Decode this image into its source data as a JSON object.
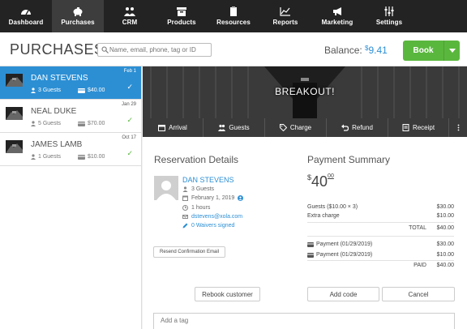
{
  "nav": [
    {
      "label": "Dashboard",
      "icon": "speedometer-icon"
    },
    {
      "label": "Purchases",
      "icon": "piggy-bank-icon"
    },
    {
      "label": "CRM",
      "icon": "people-icon"
    },
    {
      "label": "Products",
      "icon": "box-icon"
    },
    {
      "label": "Resources",
      "icon": "clipboard-icon"
    },
    {
      "label": "Reports",
      "icon": "line-chart-icon"
    },
    {
      "label": "Marketing",
      "icon": "megaphone-icon"
    },
    {
      "label": "Settings",
      "icon": "sliders-icon"
    }
  ],
  "header": {
    "title": "PURCHASES",
    "search_placeholder": "Name, email, phone, tag or ID",
    "balance_label": "Balance:",
    "balance_currency": "$",
    "balance_amount": "9.41",
    "book_label": "Book"
  },
  "bookings": [
    {
      "name": "DAN STEVENS",
      "date": "Feb 1",
      "guests": "3 Guests",
      "price": "$40.00",
      "active": true
    },
    {
      "name": "NEAL DUKE",
      "date": "Jan 29",
      "guests": "5 Guests",
      "price": "$70.00",
      "active": false
    },
    {
      "name": "JAMES LAMB",
      "date": "Oct 17",
      "guests": "1 Guests",
      "price": "$10.00",
      "active": false
    }
  ],
  "banner": {
    "title": "BREAKOUT!"
  },
  "actions": [
    {
      "label": "Arrival",
      "icon": "calendar-icon"
    },
    {
      "label": "Guests",
      "icon": "people-icon"
    },
    {
      "label": "Charge",
      "icon": "tag-icon"
    },
    {
      "label": "Refund",
      "icon": "undo-icon"
    },
    {
      "label": "Receipt",
      "icon": "receipt-icon"
    },
    {
      "label": "",
      "icon": "more-vertical-icon"
    }
  ],
  "reservation": {
    "title": "Reservation Details",
    "customer_name": "DAN STEVENS",
    "guests": "3 Guests",
    "date": "February 1, 2019",
    "duration": "1 hours",
    "email": "dstevens@xola.com",
    "waivers": "0 Waivers signed",
    "resend_label": "Resend Confirmation Email",
    "rebook_label": "Rebook customer"
  },
  "payment": {
    "title": "Payment Summary",
    "currency": "$",
    "amount": "40",
    "cents": "00",
    "lines": [
      {
        "label": "Guests ($10.00 × 3)",
        "value": "$30.00"
      },
      {
        "label": "Extra charge",
        "value": "$10.00"
      }
    ],
    "total_label": "TOTAL",
    "total_value": "$40.00",
    "payments": [
      {
        "label": "Payment (01/29/2019)",
        "value": "$30.00"
      },
      {
        "label": "Payment (01/29/2019)",
        "value": "$10.00"
      }
    ],
    "paid_label": "PAID",
    "paid_value": "$40.00",
    "add_code_label": "Add code",
    "cancel_label": "Cancel"
  },
  "tag": {
    "placeholder": "Add a tag"
  },
  "colors": {
    "accent": "#2c8fd4",
    "book": "#5ab73e",
    "nav": "#232323"
  }
}
